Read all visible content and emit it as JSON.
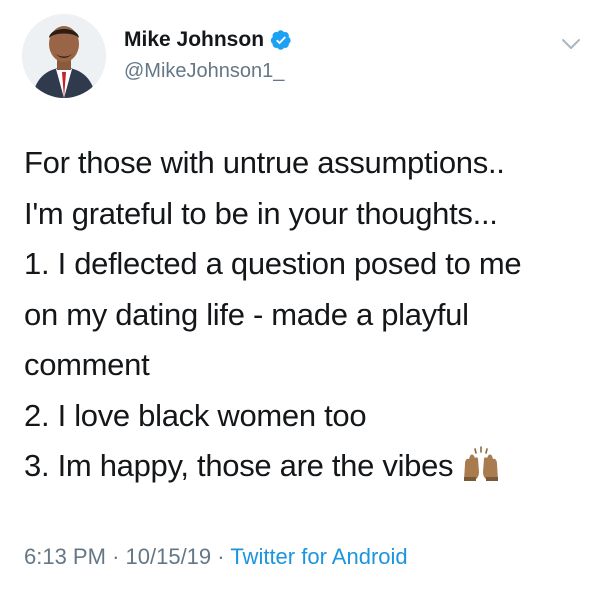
{
  "tweet": {
    "author": {
      "display_name": "Mike Johnson",
      "handle": "@MikeJohnson1_",
      "verified": true,
      "avatar_icon": "profile-photo"
    },
    "menu_icon": "chevron-down-icon",
    "text_lines": [
      "For those with untrue assumptions..",
      "I'm grateful to be in your thoughts...",
      "1. I deflected a question posed to me",
      "on my dating life - made a playful",
      "comment",
      "2. I love black women too",
      "3. Im happy, those are the vibes"
    ],
    "emoji": "raising-hands-emoji",
    "time": "6:13 PM",
    "date": "10/15/19",
    "separator": "·",
    "source": "Twitter for Android"
  },
  "colors": {
    "text": "#14171a",
    "secondary": "#657786",
    "link": "#1b95e0",
    "verified": "#1da1f2"
  }
}
